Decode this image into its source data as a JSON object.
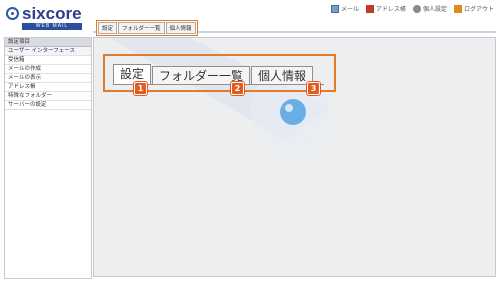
{
  "brand": {
    "name": "sixcore",
    "tagline": "WEB MAIL"
  },
  "topnav": [
    {
      "label": "メール",
      "icon": "mail-icon"
    },
    {
      "label": "アドレス帳",
      "icon": "address-book-icon"
    },
    {
      "label": "個人設定",
      "icon": "gear-icon"
    },
    {
      "label": "ログアウト",
      "icon": "logout-icon"
    }
  ],
  "sidebar": {
    "header": "設定項目",
    "items": [
      "ユーザー インターフェース",
      "受信箱",
      "メールの作成",
      "メールの表示",
      "アドレス帳",
      "特殊なフォルダー",
      "サーバーの設定"
    ]
  },
  "small_tabs": [
    "設定",
    "フォルダー一覧",
    "個人情報"
  ],
  "zoom_tabs": [
    "設定",
    "フォルダー一覧",
    "個人情報"
  ],
  "badges": [
    "1",
    "2",
    "3"
  ],
  "colors": {
    "accent": "#e37a2a",
    "brand": "#2b3e8f",
    "badge": "#e35b1e"
  }
}
